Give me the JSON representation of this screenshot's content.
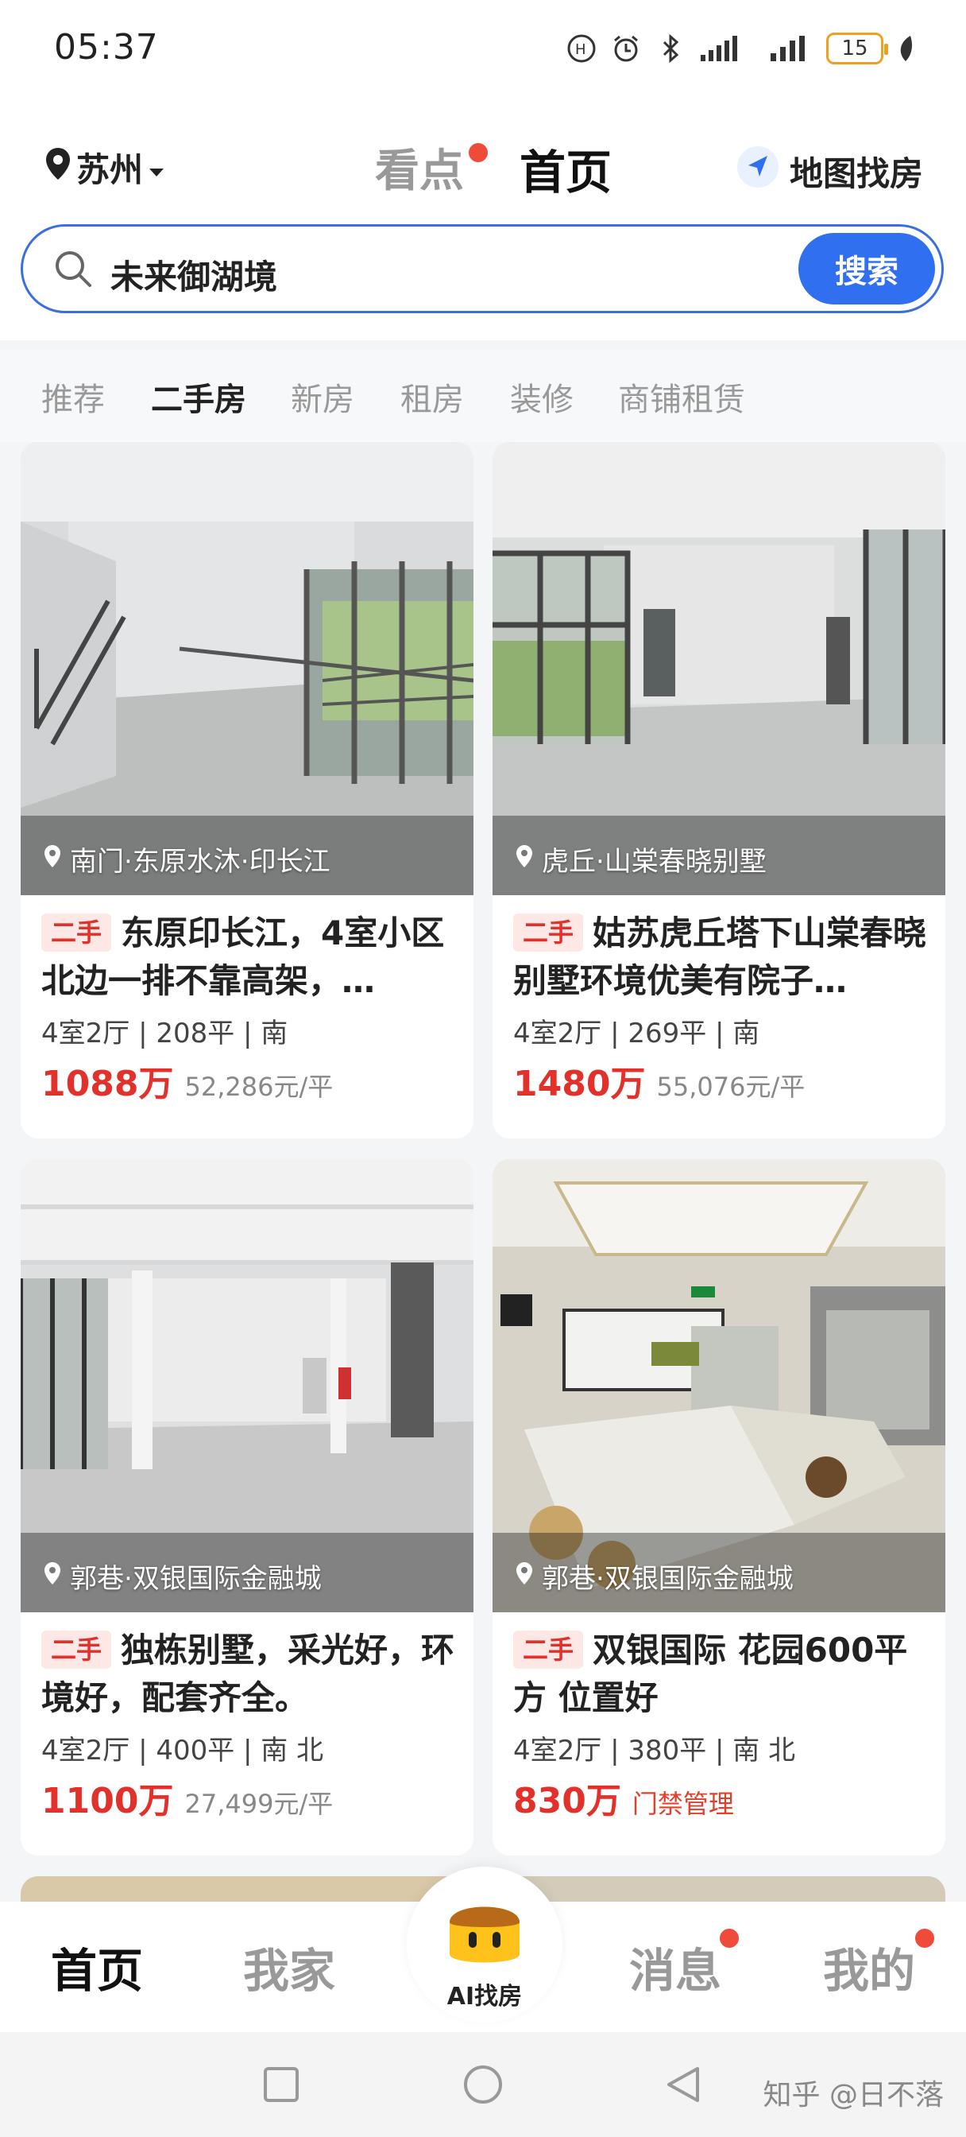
{
  "status_bar": {
    "time": "05:37",
    "battery": "15"
  },
  "top_nav": {
    "city": "苏州",
    "tab_kandian": "看点",
    "tab_home": "首页",
    "map_find": "地图找房"
  },
  "search": {
    "value": "未来御湖境",
    "button": "搜索"
  },
  "category_tabs": [
    "推荐",
    "二手房",
    "新房",
    "租房",
    "装修",
    "商铺租赁"
  ],
  "listings": [
    {
      "location": "南门·东原水沐·印长江",
      "tag": "二手",
      "title": "东原印长江，4室小区北边一排不靠高架，…",
      "specs": "4室2厅 | 208平 | 南",
      "price": "1088万",
      "unit_price": "52,286元/平"
    },
    {
      "location": "虎丘·山棠春晓别墅",
      "tag": "二手",
      "title": "姑苏虎丘塔下山棠春晓别墅环境优美有院子…",
      "specs": "4室2厅 | 269平 | 南",
      "price": "1480万",
      "unit_price": "55,076元/平"
    },
    {
      "location": "郭巷·双银国际金融城",
      "tag": "二手",
      "title": "独栋别墅，采光好，环境好，配套齐全。",
      "specs": "4室2厅 | 400平 | 南 北",
      "price": "1100万",
      "unit_price": "27,499元/平"
    },
    {
      "location": "郭巷·双银国际金融城",
      "tag": "二手",
      "title": "双银国际 花园600平方 位置好",
      "specs": "4室2厅 | 380平 | 南 北",
      "price": "830万",
      "unit_price": "门禁管理"
    }
  ],
  "tab_bar": {
    "home": "首页",
    "my_home": "我家",
    "ai": "AI找房",
    "messages": "消息",
    "mine": "我的"
  },
  "watermark": "知乎 @日不落",
  "colors": {
    "accent": "#2f6ff0",
    "price": "#e2302a",
    "badge": "#f04a3a"
  }
}
